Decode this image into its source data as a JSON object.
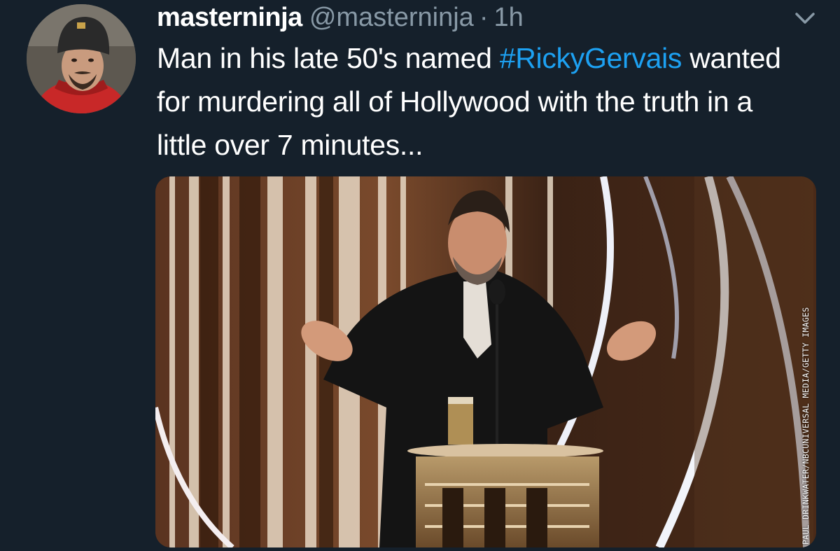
{
  "tweet": {
    "author": {
      "display_name": "masterninja",
      "handle": "@masterninja",
      "separator": "·",
      "timestamp": "1h"
    },
    "text_before": "Man in his late 50's named ",
    "hashtag": "#RickyGervais",
    "text_after": " wanted for murdering all of Hollywood with the truth in a little over 7 minutes...",
    "media": {
      "photo_credit": "PAUL DRINKWATER/NBCUNIVERSAL MEDIA/GETTY IMAGES"
    }
  },
  "icons": {
    "menu": "chevron-down-icon"
  },
  "colors": {
    "background": "#15202b",
    "text": "#ffffff",
    "secondary": "#8899a6",
    "hashtag": "#1da1f2"
  }
}
